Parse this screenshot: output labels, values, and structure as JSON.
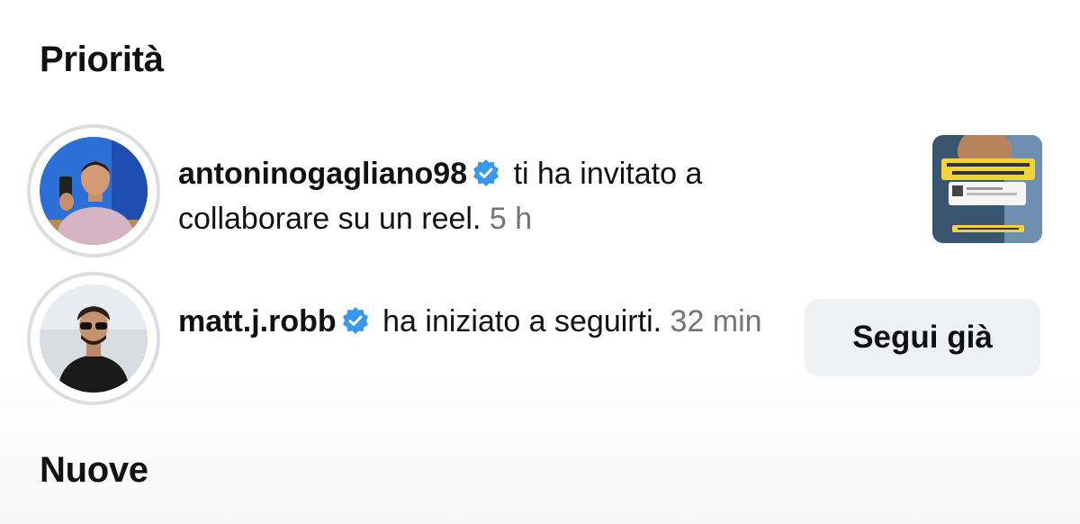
{
  "sections": {
    "priority_title": "Priorità",
    "new_title": "Nuove"
  },
  "notifications": [
    {
      "username": "antoninogagliano98",
      "verified": true,
      "message": "ti ha invitato a collaborare su un reel.",
      "time": "5 h",
      "thumbnail_icon": "reel-thumbnail"
    },
    {
      "username": "matt.j.robb",
      "verified": true,
      "message": "ha iniziato a seguirti.",
      "time": "32 min",
      "button_label": "Segui già"
    }
  ],
  "colors": {
    "verified_badge": "#3897f0",
    "time_text": "#737378",
    "button_bg": "#eff0f3",
    "avatar_ring": "#dcdde2"
  }
}
